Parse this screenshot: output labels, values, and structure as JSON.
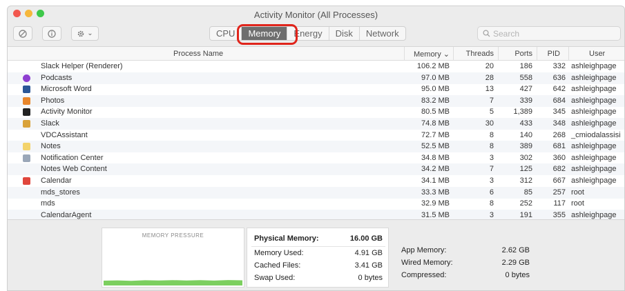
{
  "window": {
    "title": "Activity Monitor (All Processes)"
  },
  "toolbar": {
    "stop_icon": "stop-process-icon",
    "info_icon": "info-icon",
    "gear_icon": "gear-icon",
    "gear_chevron": "⌄",
    "tabs": [
      {
        "label": "CPU",
        "active": false
      },
      {
        "label": "Memory",
        "active": true
      },
      {
        "label": "Energy",
        "active": false
      },
      {
        "label": "Disk",
        "active": false
      },
      {
        "label": "Network",
        "active": false
      }
    ],
    "search_placeholder": "Search",
    "highlight_color": "#e0241b"
  },
  "table": {
    "columns": {
      "name": "Process Name",
      "memory": "Memory ⌄",
      "threads": "Threads",
      "ports": "Ports",
      "pid": "PID",
      "user": "User"
    },
    "rows": [
      {
        "icon": "none",
        "color": "",
        "name": "Slack Helper (Renderer)",
        "memory": "106.2 MB",
        "threads": "20",
        "ports": "186",
        "pid": "332",
        "user": "ashleighpage"
      },
      {
        "icon": "podcasts-icon",
        "color": "#8e3fd1",
        "name": "Podcasts",
        "memory": "97.0 MB",
        "threads": "28",
        "ports": "558",
        "pid": "636",
        "user": "ashleighpage"
      },
      {
        "icon": "word-icon",
        "color": "#2b5797",
        "name": "Microsoft Word",
        "memory": "95.0 MB",
        "threads": "13",
        "ports": "427",
        "pid": "642",
        "user": "ashleighpage"
      },
      {
        "icon": "photos-icon",
        "color": "#e8862b",
        "name": "Photos",
        "memory": "83.2 MB",
        "threads": "7",
        "ports": "339",
        "pid": "684",
        "user": "ashleighpage"
      },
      {
        "icon": "activity-monitor-icon",
        "color": "#222222",
        "name": "Activity Monitor",
        "memory": "80.5 MB",
        "threads": "5",
        "ports": "1,389",
        "pid": "345",
        "user": "ashleighpage"
      },
      {
        "icon": "slack-icon",
        "color": "#d9a23a",
        "name": "Slack",
        "memory": "74.8 MB",
        "threads": "30",
        "ports": "433",
        "pid": "348",
        "user": "ashleighpage"
      },
      {
        "icon": "none",
        "color": "",
        "name": "VDCAssistant",
        "memory": "72.7 MB",
        "threads": "8",
        "ports": "140",
        "pid": "268",
        "user": "_cmiodalassisi"
      },
      {
        "icon": "notes-icon",
        "color": "#f3d36b",
        "name": "Notes",
        "memory": "52.5 MB",
        "threads": "8",
        "ports": "389",
        "pid": "681",
        "user": "ashleighpage"
      },
      {
        "icon": "notification-center-icon",
        "color": "#9aa7b8",
        "name": "Notification Center",
        "memory": "34.8 MB",
        "threads": "3",
        "ports": "302",
        "pid": "360",
        "user": "ashleighpage"
      },
      {
        "icon": "none",
        "color": "",
        "name": "Notes Web Content",
        "memory": "34.2 MB",
        "threads": "7",
        "ports": "125",
        "pid": "682",
        "user": "ashleighpage"
      },
      {
        "icon": "calendar-icon",
        "color": "#e0463c",
        "name": "Calendar",
        "memory": "34.1 MB",
        "threads": "3",
        "ports": "312",
        "pid": "667",
        "user": "ashleighpage"
      },
      {
        "icon": "none",
        "color": "",
        "name": "mds_stores",
        "memory": "33.3 MB",
        "threads": "6",
        "ports": "85",
        "pid": "257",
        "user": "root"
      },
      {
        "icon": "none",
        "color": "",
        "name": "mds",
        "memory": "32.9 MB",
        "threads": "8",
        "ports": "252",
        "pid": "117",
        "user": "root"
      },
      {
        "icon": "none",
        "color": "",
        "name": "CalendarAgent",
        "memory": "31.5 MB",
        "threads": "3",
        "ports": "191",
        "pid": "355",
        "user": "ashleighpage"
      }
    ]
  },
  "footer": {
    "pressure_label": "MEMORY PRESSURE",
    "pressure_color": "#7ccf5f",
    "physical_memory_label": "Physical Memory:",
    "physical_memory_value": "16.00 GB",
    "memory_used_label": "Memory Used:",
    "memory_used_value": "4.91 GB",
    "cached_files_label": "Cached Files:",
    "cached_files_value": "3.41 GB",
    "swap_used_label": "Swap Used:",
    "swap_used_value": "0 bytes",
    "app_memory_label": "App Memory:",
    "app_memory_value": "2.62 GB",
    "wired_memory_label": "Wired Memory:",
    "wired_memory_value": "2.29 GB",
    "compressed_label": "Compressed:",
    "compressed_value": "0 bytes"
  }
}
